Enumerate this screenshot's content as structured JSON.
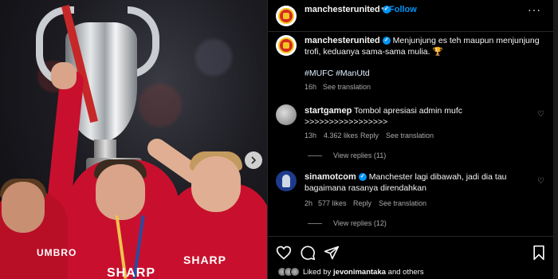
{
  "post": {
    "username": "manchesterunited",
    "follow_label": "Follow",
    "dot": "•",
    "more": "···"
  },
  "caption": {
    "username": "manchesterunited",
    "text": "Menjunjung es teh maupun menjunjung trofi, keduanya sama-sama mulia. 🏆",
    "hashtags": "#MUFC #ManUtd",
    "time": "16h",
    "see_translation": "See translation"
  },
  "comments": [
    {
      "username": "startgamep",
      "text": "Tombol apresiasi admin mufc >>>>>>>>>>>>>>>>>",
      "time": "13h",
      "likes": "4.362 likes",
      "reply": "Reply",
      "see_translation": "See translation",
      "view_replies": "View replies (11)"
    },
    {
      "username": "sinamotcom",
      "text": "Manchester lagi dibawah, jadi dia tau bagaimana rasanya direndahkan",
      "time": "2h",
      "likes": "577 likes",
      "reply": "Reply",
      "see_translation": "See translation",
      "view_replies": "View replies (12)"
    }
  ],
  "likes_line": {
    "prefix": "Liked by",
    "user": "jevonimantaka",
    "suffix": "and others"
  },
  "media": {
    "sponsor": "SHARP",
    "sponsor_kit": "UMBRO"
  },
  "colors": {
    "accent": "#0095f6",
    "background": "#000000",
    "muted": "#a8a8a8",
    "kit_red": "#c8102e"
  },
  "icons": [
    "verified-badge-icon",
    "more-icon",
    "heart-icon",
    "comment-icon",
    "share-icon",
    "bookmark-icon",
    "chevron-right-icon",
    "trophy-emoji"
  ]
}
